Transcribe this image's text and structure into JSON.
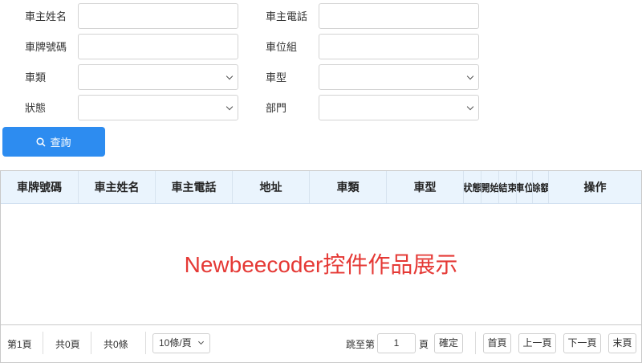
{
  "form": {
    "owner_name_label": "車主姓名",
    "owner_phone_label": "車主電話",
    "plate_label": "車牌號碼",
    "slot_group_label": "車位組",
    "car_class_label": "車類",
    "car_model_label": "車型",
    "status_label": "狀態",
    "department_label": "部門",
    "owner_name_value": "",
    "owner_phone_value": "",
    "plate_value": "",
    "slot_group_value": "",
    "car_class_value": "",
    "car_model_value": "",
    "status_value": "",
    "department_value": ""
  },
  "query_button": {
    "label": "查詢",
    "icon": "search-icon",
    "color": "#2d8cf0"
  },
  "grid": {
    "columns": [
      "車牌號碼",
      "車主姓名",
      "車主電話",
      "地址",
      "車類",
      "車型",
      "狀態",
      "開始",
      "結束",
      "車位",
      "餘額",
      "操作"
    ],
    "rows": [],
    "header_bg": "#eaf4fd"
  },
  "watermark": {
    "text": "Newbeecoder控件作品展示",
    "color": "#e53935"
  },
  "pager": {
    "current_page": "第1頁",
    "total_pages": "共0頁",
    "total_rows": "共0條",
    "page_size": "10條/頁",
    "jump_to": "跳至第",
    "jump_value": "1",
    "page_unit": "頁",
    "confirm": "確定",
    "first": "首頁",
    "prev": "上一頁",
    "next": "下一頁",
    "last": "末頁"
  }
}
